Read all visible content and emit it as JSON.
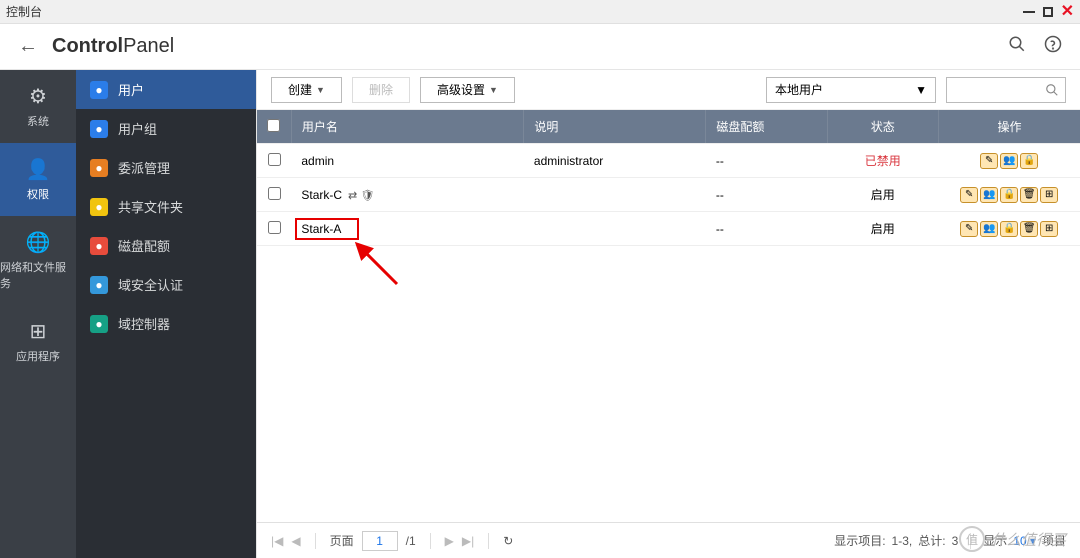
{
  "window": {
    "title": "控制台"
  },
  "header": {
    "title_bold": "Control",
    "title_light": "Panel"
  },
  "sidebar_l1": [
    {
      "label": "系统",
      "icon": "⚙"
    },
    {
      "label": "权限",
      "icon": "👤",
      "active": true
    },
    {
      "label": "网络和文件服务",
      "icon": "🌐"
    },
    {
      "label": "应用程序",
      "icon": "⊞"
    }
  ],
  "sidebar_l2": [
    {
      "label": "用户",
      "color": "#2b7de9",
      "active": true
    },
    {
      "label": "用户组",
      "color": "#2b7de9"
    },
    {
      "label": "委派管理",
      "color": "#e67e22"
    },
    {
      "label": "共享文件夹",
      "color": "#f1c40f"
    },
    {
      "label": "磁盘配额",
      "color": "#e74c3c"
    },
    {
      "label": "域安全认证",
      "color": "#3498db"
    },
    {
      "label": "域控制器",
      "color": "#16a085"
    }
  ],
  "toolbar": {
    "create": "创建",
    "delete": "删除",
    "advanced": "高级设置",
    "user_scope": "本地用户"
  },
  "table": {
    "columns": {
      "username": "用户名",
      "description": "说明",
      "quota": "磁盘配额",
      "status": "状态",
      "ops": "操作"
    },
    "rows": [
      {
        "username": "admin",
        "description": "administrator",
        "quota": "--",
        "status": "已禁用",
        "status_cls": "status-disabled",
        "ops": 3,
        "extra": false,
        "highlight": false
      },
      {
        "username": "Stark-C",
        "description": "",
        "quota": "--",
        "status": "启用",
        "status_cls": "",
        "ops": 5,
        "extra": true,
        "highlight": false
      },
      {
        "username": "Stark-A",
        "description": "",
        "quota": "--",
        "status": "启用",
        "status_cls": "",
        "ops": 5,
        "extra": false,
        "highlight": true
      }
    ]
  },
  "pager": {
    "page_label": "页面",
    "page": "1",
    "total_pages": "/1",
    "summary_prefix": "显示项目:",
    "summary_range": "1-3,",
    "summary_total_label": "总计:",
    "summary_total": "3",
    "show_label": "显示",
    "page_size": "10",
    "item_label": "项目"
  },
  "watermark": {
    "badge": "值",
    "text": "什么值得买"
  },
  "op_glyphs": [
    "✎",
    "👥",
    "🔒",
    "🗑",
    "⊞"
  ]
}
